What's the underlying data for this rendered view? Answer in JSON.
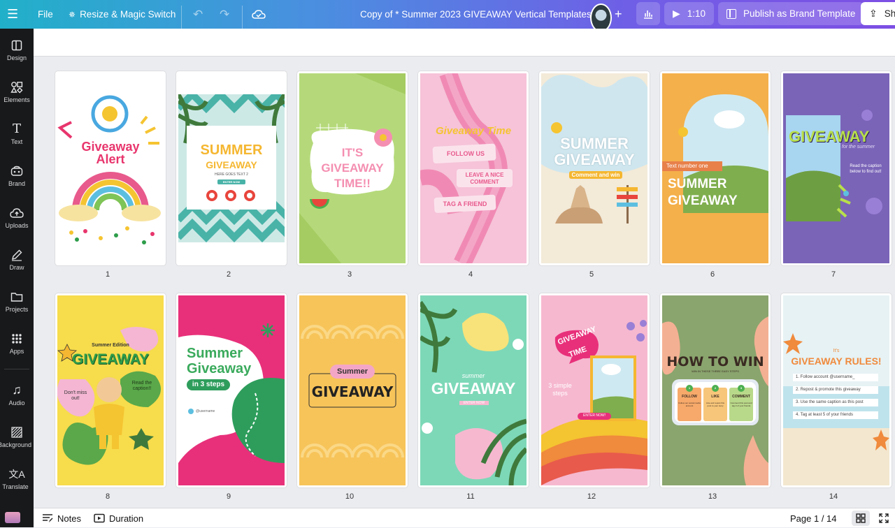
{
  "topbar": {
    "file_label": "File",
    "resize_label": "Resize & Magic Switch",
    "doc_title": "Copy of * Summer 2023 GIVEAWAY Vertical Templates",
    "duration_label": "1:10",
    "publish_label": "Publish as Brand Template",
    "share_label": "Sh"
  },
  "sidebar": {
    "items": [
      {
        "label": "Design",
        "icon": "design-icon"
      },
      {
        "label": "Elements",
        "icon": "elements-icon"
      },
      {
        "label": "Text",
        "icon": "text-icon"
      },
      {
        "label": "Brand",
        "icon": "brand-icon"
      },
      {
        "label": "Uploads",
        "icon": "uploads-icon"
      },
      {
        "label": "Draw",
        "icon": "draw-icon"
      },
      {
        "label": "Projects",
        "icon": "projects-icon"
      },
      {
        "label": "Apps",
        "icon": "apps-icon"
      },
      {
        "label": "Audio",
        "icon": "audio-icon"
      },
      {
        "label": "Background",
        "icon": "background-icon"
      },
      {
        "label": "Translate",
        "icon": "translate-icon"
      }
    ]
  },
  "pages": [
    {
      "num": "1",
      "bg": "#ffffff",
      "lines": [
        "Giveaway",
        "Alert"
      ],
      "color": "#e8356d"
    },
    {
      "num": "2",
      "bg": "#ffffff",
      "lines": [
        "SUMMER",
        "GIVEAWAY",
        "HERE GOES TEXT 2",
        "ENTER NOW"
      ],
      "color": "#f5b731"
    },
    {
      "num": "3",
      "bg": "#b5d97a",
      "lines": [
        "IT'S",
        "GIVEAWAY",
        "TIME!!"
      ],
      "color": "#f48fb1"
    },
    {
      "num": "4",
      "bg": "#f6c3d8",
      "lines": [
        "Giveaway Time",
        "FOLLOW US",
        "LEAVE A NICE",
        "COMMENT",
        "TAG A FRIEND"
      ],
      "color": "#e85a8c"
    },
    {
      "num": "5",
      "bg": "#f3ead8",
      "lines": [
        "SUMMER",
        "GIVEAWAY",
        "Comment and win"
      ],
      "color": "#ffffff"
    },
    {
      "num": "6",
      "bg": "#f4b04a",
      "lines": [
        "Text number one",
        "SUMMER",
        "GIVEAWAY"
      ],
      "color": "#ffffff"
    },
    {
      "num": "7",
      "bg": "#7a64b8",
      "lines": [
        "GIVEAWAY",
        "for the summer",
        "Read the caption",
        "below to find out!"
      ],
      "color": "#b8e04a"
    },
    {
      "num": "8",
      "bg": "#f7dc4c",
      "lines": [
        "Summer Edition",
        "GIVEAWAY",
        "Don't miss",
        "out!",
        "Read the",
        "caption!!"
      ],
      "color": "#2e9d4a"
    },
    {
      "num": "9",
      "bg": "#e8307a",
      "lines": [
        "Summer",
        "Giveaway",
        "in 3 steps",
        "@username"
      ],
      "color": "#3aaa5c"
    },
    {
      "num": "10",
      "bg": "#f7c45a",
      "lines": [
        "Summer",
        "GIVEAWAY"
      ],
      "color": "#222222"
    },
    {
      "num": "11",
      "bg": "#7dd8b8",
      "lines": [
        "summer",
        "GIVEAWAY",
        "ENTER NOW"
      ],
      "color": "#ffffff"
    },
    {
      "num": "12",
      "bg": "#f6b8cf",
      "lines": [
        "GIVEAWAY",
        "TIME",
        "3 simple",
        "steps",
        "ENTER NOW!"
      ],
      "color": "#ffffff"
    },
    {
      "num": "13",
      "bg": "#8aa56e",
      "lines": [
        "HOW TO WIN",
        "WIN IN THESE THREE EASY STEPS",
        "FOLLOW",
        "LIKE",
        "COMMENT",
        "Follow our social media account",
        "Like and repost this post to your story",
        "Comment this post and tag 3 of your friends",
        "1",
        "2",
        "3"
      ],
      "color": "#3a2a22"
    },
    {
      "num": "14",
      "bg": "#e6f2f4",
      "lines": [
        "It's",
        "GIVEAWAY RULES!",
        "1. Follow account @username_",
        "2. Repost & promote this giveaway",
        "3. Use the same caption as this post",
        "4. Tag at least 5 of your friends"
      ],
      "color": "#f08a3c"
    }
  ],
  "bottombar": {
    "notes_label": "Notes",
    "duration_label": "Duration",
    "page_indicator": "Page 1 / 14"
  }
}
